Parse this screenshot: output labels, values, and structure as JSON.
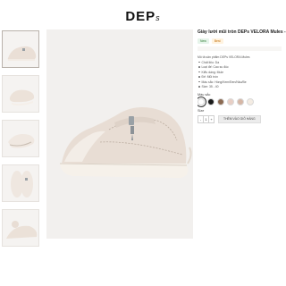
{
  "header": {
    "logo_main": "DEP",
    "logo_suffix": "s"
  },
  "product": {
    "title": "Giày lười mũi tròn DEPs VELORA Mules - nhiều",
    "badges": [
      "New",
      "Best"
    ],
    "specs_intro": "Mô tả sản phẩm DEPs VELORA Mules",
    "specs": [
      "Chất liệu: Da",
      "Loại đế: Cao su đúc",
      "Kiểu dáng: Mule",
      "Đế: Mũi tròn",
      "Màu sắc: Hồng/Kem/Đen/Nâu/Be",
      "Size: 35 - 40"
    ],
    "color_label": "Màu sắc",
    "colors": [
      "#ffffff",
      "#1a1a1a",
      "#8b6a52",
      "#e8cfc5",
      "#d6b7a6",
      "#f4ece3"
    ],
    "size_label": "Size",
    "quantity": "1",
    "minus": "-",
    "plus": "+",
    "add_to_cart": "THÊM VÀO GIỎ HÀNG"
  }
}
